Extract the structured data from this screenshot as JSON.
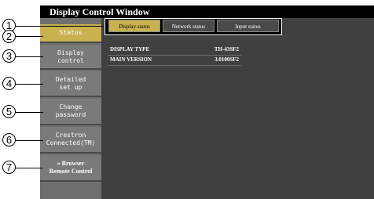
{
  "window": {
    "title": "Display Control Window"
  },
  "sidebar": {
    "items": [
      {
        "label": "Status",
        "active": true
      },
      {
        "label": "Display\ncontrol"
      },
      {
        "label": "Detailed\nset up"
      },
      {
        "label": "Change\npassword"
      },
      {
        "label": "Crestron\nConnected(TM)"
      },
      {
        "label": "» Browser\nRemote Control"
      }
    ]
  },
  "tabs": [
    {
      "label": "Display status",
      "active": true
    },
    {
      "label": "Network status"
    },
    {
      "label": "Input status"
    }
  ],
  "info": [
    {
      "key": "DISPLAY TYPE",
      "value": "TH-43SF2"
    },
    {
      "key": "MAIN VERSION",
      "value": "3.0100SF2"
    }
  ],
  "callouts": [
    "1",
    "2",
    "3",
    "4",
    "5",
    "6",
    "7"
  ],
  "colors": {
    "active": "#c9b24e",
    "background": "#404040",
    "sidebar": "#6f6f6f",
    "titlebar": "#000000"
  }
}
